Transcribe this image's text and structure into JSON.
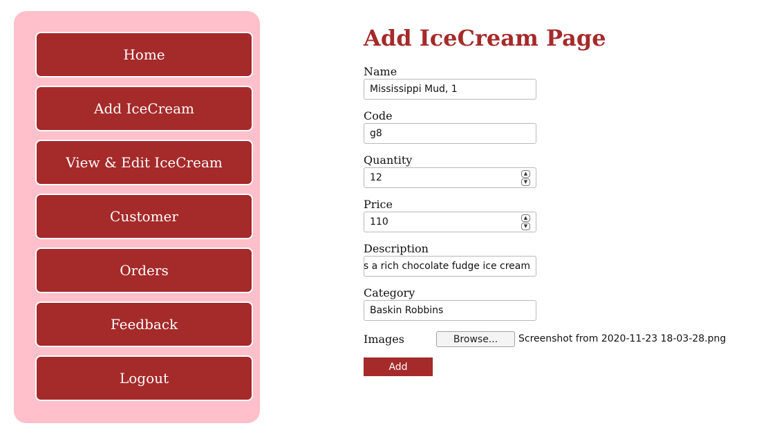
{
  "nav": {
    "items": [
      {
        "label": "Home"
      },
      {
        "label": "Add IceCream"
      },
      {
        "label": "View & Edit IceCream"
      },
      {
        "label": "Customer"
      },
      {
        "label": "Orders"
      },
      {
        "label": "Feedback"
      },
      {
        "label": "Logout"
      }
    ]
  },
  "page": {
    "title": "Add IceCream Page"
  },
  "form": {
    "name": {
      "label": "Name",
      "value": "Mississippi Mud, 1"
    },
    "code": {
      "label": "Code",
      "value": "g8"
    },
    "quantity": {
      "label": "Quantity",
      "value": "12"
    },
    "price": {
      "label": "Price",
      "value": "110"
    },
    "description": {
      "label": "Description",
      "value": "e is a rich chocolate fudge ice cream"
    },
    "category": {
      "label": "Category",
      "value": "Baskin Robbins"
    },
    "images": {
      "label": "Images",
      "browse_label": "Browse...",
      "file_name": "Screenshot from 2020-11-23 18-03-28.png"
    },
    "submit_label": "Add"
  },
  "colors": {
    "accent": "#a52a2a",
    "sidebar_bg": "#ffc0cb"
  }
}
